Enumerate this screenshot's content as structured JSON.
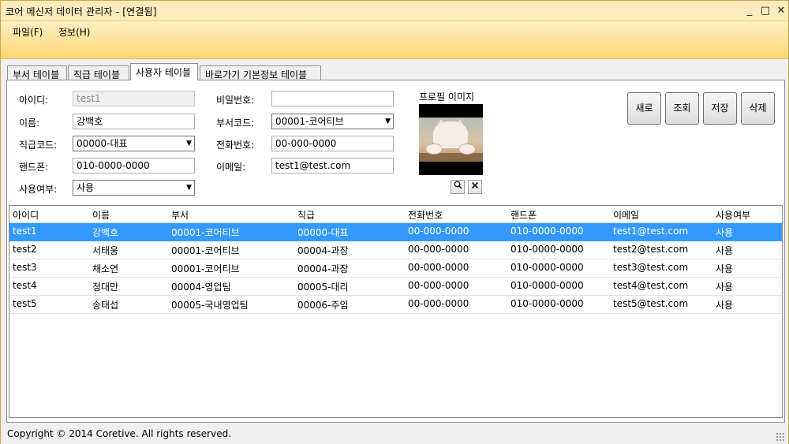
{
  "window": {
    "title": "코어 메신저 데이터 관리자 - [연결됨]",
    "minimize": "_",
    "maximize": "□",
    "close": "✕"
  },
  "menu": {
    "file": "파일(F)",
    "info": "정보(H)"
  },
  "tabs": [
    {
      "label": "부서 테이블"
    },
    {
      "label": "직급 테이블"
    },
    {
      "label": "사용자 테이블"
    },
    {
      "label": "바로가기 기본정보 테이블"
    }
  ],
  "form": {
    "id_label": "아이디:",
    "id_value": "test1",
    "name_label": "이름:",
    "name_value": "강백호",
    "rank_label": "직급코드:",
    "rank_value": "00000-대표",
    "mobile_label": "핸드폰:",
    "mobile_value": "010-0000-0000",
    "usage_label": "사용여부:",
    "usage_value": "사용",
    "password_label": "비밀번호:",
    "password_value": "",
    "dept_label": "부서코드:",
    "dept_value": "00001-코어티브",
    "phone_label": "전화번호:",
    "phone_value": "00-000-0000",
    "email_label": "이메일:",
    "email_value": "test1@test.com",
    "profile_label": "프로필 이미지"
  },
  "buttons": {
    "new": "새로",
    "search": "조회",
    "save": "저장",
    "delete": "삭제"
  },
  "grid": {
    "columns": [
      "아이디",
      "이름",
      "부서",
      "직급",
      "전화번호",
      "핸드폰",
      "이메일",
      "사용여부"
    ],
    "rows": [
      [
        "test1",
        "강백호",
        "00001-코어티브",
        "00000-대표",
        "00-000-0000",
        "010-0000-0000",
        "test1@test.com",
        "사용"
      ],
      [
        "test2",
        "서태웅",
        "00001-코어티브",
        "00004-과장",
        "00-000-0000",
        "010-0000-0000",
        "test2@test.com",
        "사용"
      ],
      [
        "test3",
        "채소연",
        "00001-코어티브",
        "00004-과장",
        "00-000-0000",
        "010-0000-0000",
        "test3@test.com",
        "사용"
      ],
      [
        "test4",
        "정대만",
        "00004-영업팀",
        "00005-대리",
        "00-000-0000",
        "010-0000-0000",
        "test4@test.com",
        "사용"
      ],
      [
        "test5",
        "송태섭",
        "00005-국내영업팀",
        "00006-주임",
        "00-000-0000",
        "010-0000-0000",
        "test5@test.com",
        "사용"
      ]
    ],
    "selected_row": 0
  },
  "status": {
    "text": "Copyright © 2014 Coretive. All rights reserved."
  },
  "colors": {
    "accent": "#fbd873",
    "selection": "#3399ff"
  }
}
